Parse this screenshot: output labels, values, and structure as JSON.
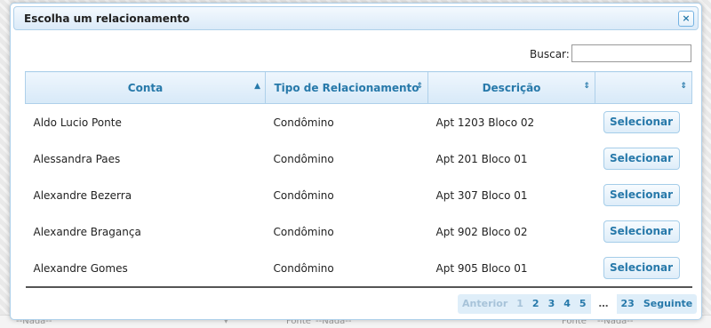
{
  "background": {
    "labels": [
      "--Nada--",
      "Fonte",
      "--Nada--",
      "Fonte",
      "--Nada--",
      "--Nada--"
    ]
  },
  "dialog": {
    "title": "Escolha um relacionamento",
    "close_icon": "×",
    "search": {
      "label": "Buscar:",
      "value": ""
    },
    "table": {
      "columns": [
        {
          "label": "Conta",
          "sort_icon": "▲"
        },
        {
          "label": "Tipo de Relacionamento",
          "sort_icon": "⇕"
        },
        {
          "label": "Descrição",
          "sort_icon": "⇕"
        },
        {
          "label": "",
          "sort_icon": "⇕"
        }
      ],
      "rows": [
        {
          "conta": "Aldo Lucio Ponte",
          "tipo": "Condômino",
          "descricao": "Apt 1203 Bloco 02",
          "action": "Selecionar"
        },
        {
          "conta": "Alessandra Paes",
          "tipo": "Condômino",
          "descricao": "Apt 201 Bloco 01",
          "action": "Selecionar"
        },
        {
          "conta": "Alexandre Bezerra",
          "tipo": "Condômino",
          "descricao": "Apt 307 Bloco 01",
          "action": "Selecionar"
        },
        {
          "conta": "Alexandre Bragança",
          "tipo": "Condômino",
          "descricao": "Apt 902 Bloco 02",
          "action": "Selecionar"
        },
        {
          "conta": "Alexandre Gomes",
          "tipo": "Condômino",
          "descricao": "Apt 905 Bloco 01",
          "action": "Selecionar"
        }
      ]
    },
    "pagination": {
      "previous": "Anterior",
      "pages": [
        "1",
        "2",
        "3",
        "4",
        "5"
      ],
      "current_page": "1",
      "ellipsis": "…",
      "last": "23",
      "next": "Seguinte"
    }
  },
  "colors": {
    "accent": "#2779aa",
    "border": "#aed0ea"
  }
}
